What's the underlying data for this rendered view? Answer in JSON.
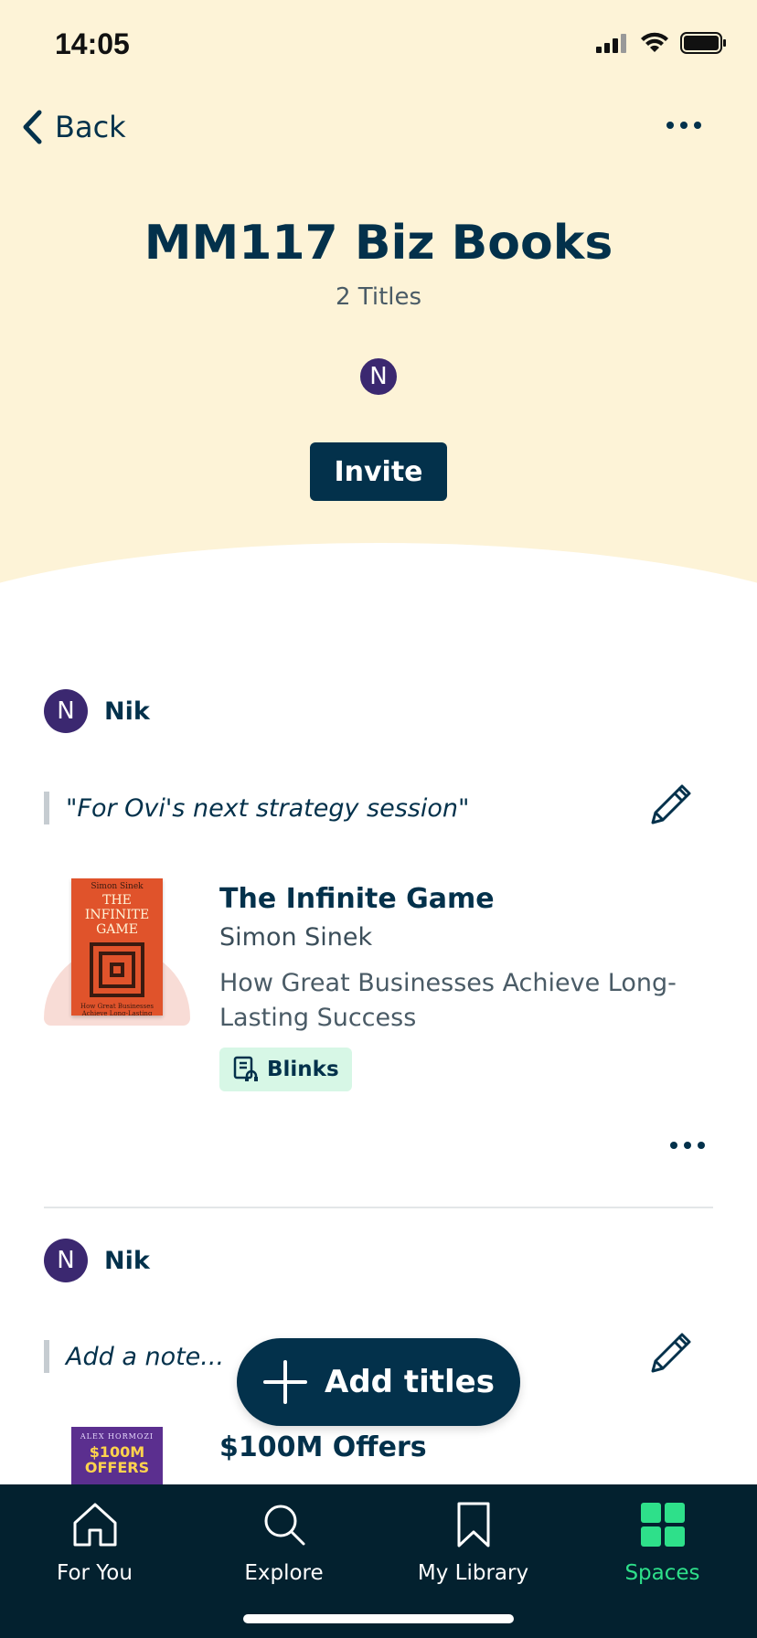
{
  "status_bar": {
    "time": "14:05"
  },
  "header": {
    "back_label": "Back",
    "title": "MM117 Biz Books",
    "count": "2 Titles",
    "avatar_initial": "N",
    "invite_label": "Invite"
  },
  "entries": [
    {
      "user_initial": "N",
      "user_name": "Nik",
      "note": "\"For Ovi's next strategy session\"",
      "book": {
        "title": "The Infinite Game",
        "author": "Simon Sinek",
        "subtitle": "How Great Businesses Achieve Long-Lasting Success",
        "badge": "Blinks",
        "cover_author": "Simon Sinek",
        "cover_title": "THE INFINITE GAME",
        "cover_subtitle": "How Great Businesses Achieve Long-Lasting Success"
      }
    },
    {
      "user_initial": "N",
      "user_name": "Nik",
      "note": "Add a note...",
      "book": {
        "title": "$100M Offers",
        "cover_author": "ALEX HORMOZI",
        "cover_title": "$100M OFFERS"
      }
    }
  ],
  "add_titles_label": "Add titles",
  "nav": {
    "items": [
      {
        "label": "For You",
        "icon": "home-icon"
      },
      {
        "label": "Explore",
        "icon": "search-icon"
      },
      {
        "label": "My Library",
        "icon": "bookmark-icon"
      },
      {
        "label": "Spaces",
        "icon": "grid-icon",
        "active": true
      }
    ]
  },
  "colors": {
    "header_bg": "#fdf3d7",
    "primary": "#03314b",
    "accent_green": "#2ee08a",
    "nav_bg": "#03212f"
  }
}
